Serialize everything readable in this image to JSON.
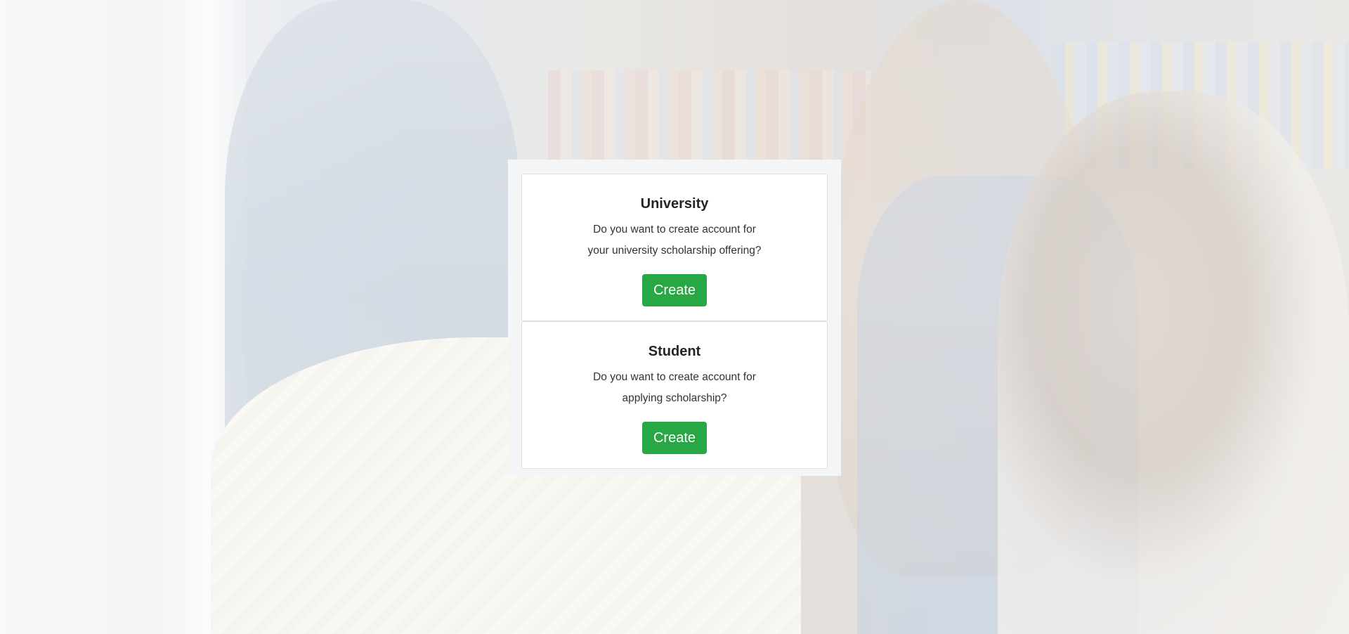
{
  "cards": [
    {
      "title": "University",
      "text_line1": "Do you want to create account for",
      "text_line2": "your university scholarship offering?",
      "button_label": "Create"
    },
    {
      "title": "Student",
      "text_line1": "Do you want to create account for",
      "text_line2": "applying scholarship?",
      "button_label": "Create"
    }
  ],
  "colors": {
    "button": "#28a745",
    "panel_background": "#f4f5f7",
    "card_background": "#ffffff"
  }
}
